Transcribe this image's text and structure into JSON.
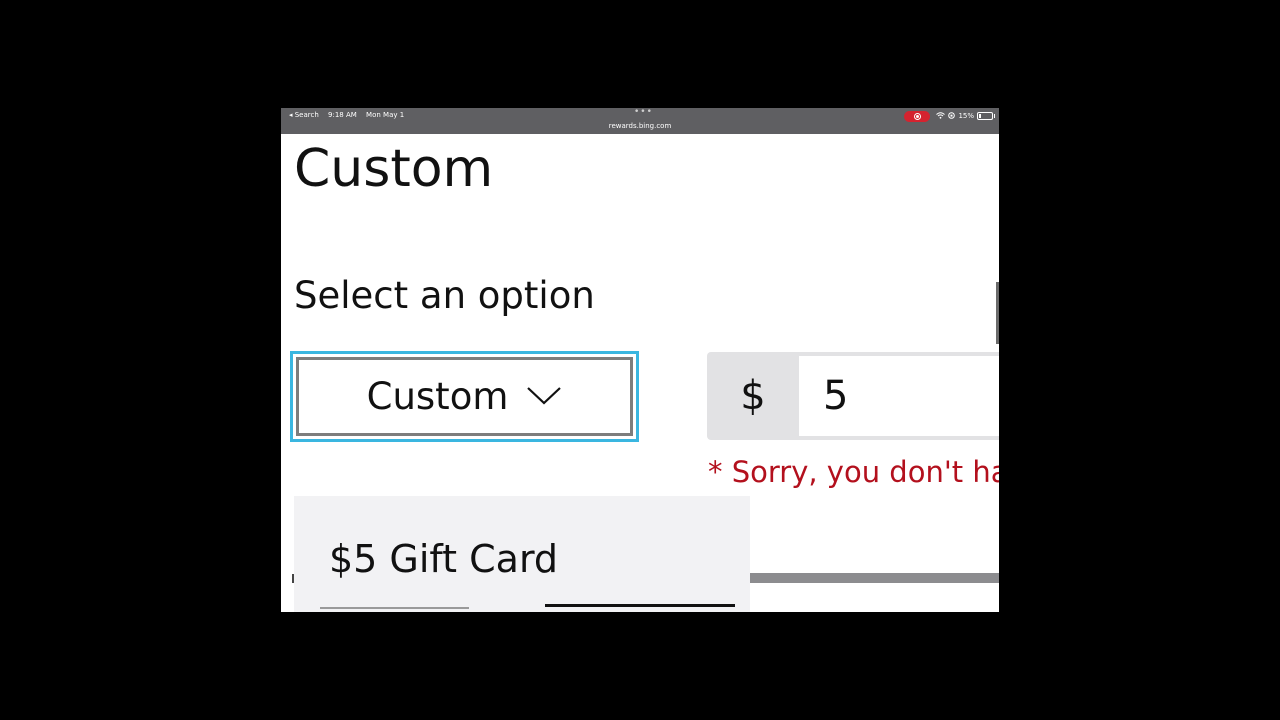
{
  "status_bar": {
    "back_label": "◂ Search",
    "time": "9:18 AM",
    "date": "Mon May 1",
    "dots": "•••",
    "url": "rewards.bing.com",
    "battery": "15%"
  },
  "page": {
    "title": "Custom",
    "select_heading": "Select an option"
  },
  "dropdown": {
    "selected_value": "Custom",
    "options": [
      "$5 Gift Card"
    ]
  },
  "amount": {
    "currency": "$",
    "value": "5"
  },
  "error_message": "* Sorry, you don't hav",
  "colors": {
    "focus_border": "#3ab6e0",
    "error": "#b3101d",
    "status_bar_bg": "#5f5f62",
    "record_pill": "#d4232f"
  }
}
